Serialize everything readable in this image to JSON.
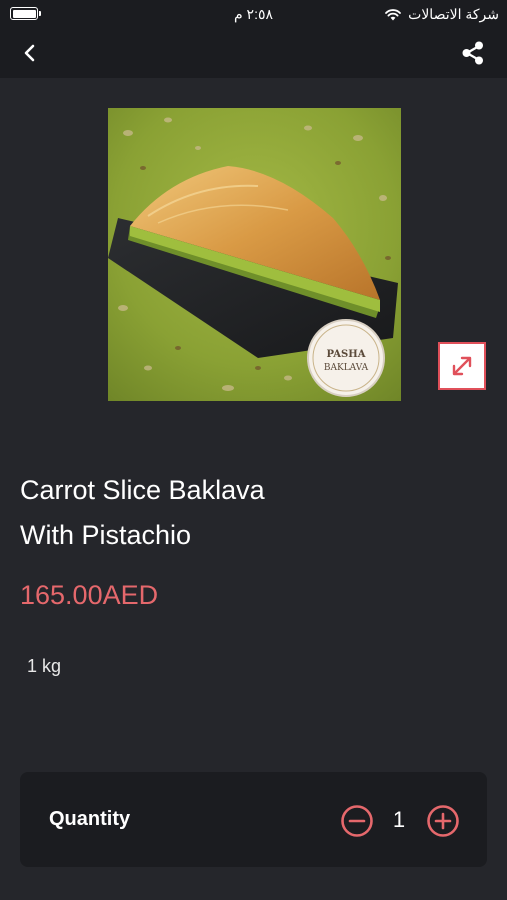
{
  "status_bar": {
    "time": "٢:٥٨ م",
    "carrier": "شركة الاتصالات"
  },
  "nav": {
    "back_icon": "chevron-left-icon",
    "share_icon": "share-icon"
  },
  "product": {
    "title_line1": "Carrot Slice Baklava",
    "title_line2": "With Pistachio",
    "price": "165.00AED",
    "weight": "1 kg",
    "logo_line1": "PASHA",
    "logo_line2": "BAKLAVA"
  },
  "quantity": {
    "label": "Quantity",
    "value": "1"
  },
  "colors": {
    "accent": "#e5686c",
    "background": "#25262b",
    "card": "#1b1c20"
  }
}
